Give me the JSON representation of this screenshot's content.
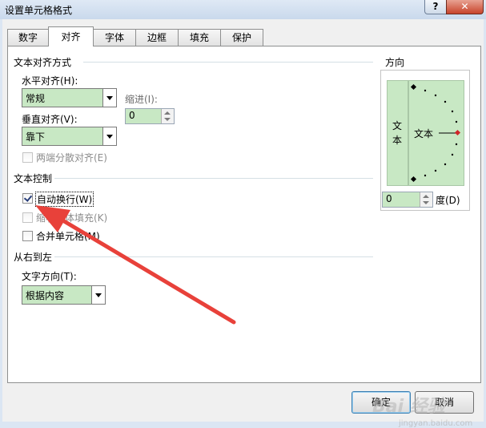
{
  "window": {
    "title": "设置单元格格式",
    "help": "?",
    "close": "✕"
  },
  "tabs": [
    {
      "label": "数字",
      "active": false
    },
    {
      "label": "对齐",
      "active": true
    },
    {
      "label": "字体",
      "active": false
    },
    {
      "label": "边框",
      "active": false
    },
    {
      "label": "填充",
      "active": false
    },
    {
      "label": "保护",
      "active": false
    }
  ],
  "text_alignment": {
    "heading": "文本对齐方式",
    "horizontal_label": "水平对齐(H):",
    "horizontal_value": "常规",
    "indent_label": "缩进(I):",
    "indent_value": "0",
    "vertical_label": "垂直对齐(V):",
    "vertical_value": "靠下",
    "distributed_label": "两端分散对齐(E)"
  },
  "text_control": {
    "heading": "文本控制",
    "wrap_label": "自动换行(W)",
    "wrap_checked": true,
    "shrink_label": "缩小字体填充(K)",
    "merge_label": "合并单元格(M)"
  },
  "rtl": {
    "heading": "从右到左",
    "direction_label": "文字方向(T):",
    "direction_value": "根据内容"
  },
  "orientation": {
    "heading": "方向",
    "vertical_text": [
      "文",
      "本"
    ],
    "dial_text": "文本",
    "degrees_value": "0",
    "degrees_label": "度(D)"
  },
  "buttons": {
    "ok": "确定",
    "cancel": "取消"
  },
  "watermark": {
    "brand": "Bai 经验",
    "url": "jingyan.baidu.com"
  },
  "colors": {
    "field_green": "#c8e8c4",
    "annotation_arrow": "#e8413a",
    "dial_marker": "#d0262a"
  },
  "annotation": {
    "icon": "red-arrow-pointing-at-wrap-text"
  }
}
